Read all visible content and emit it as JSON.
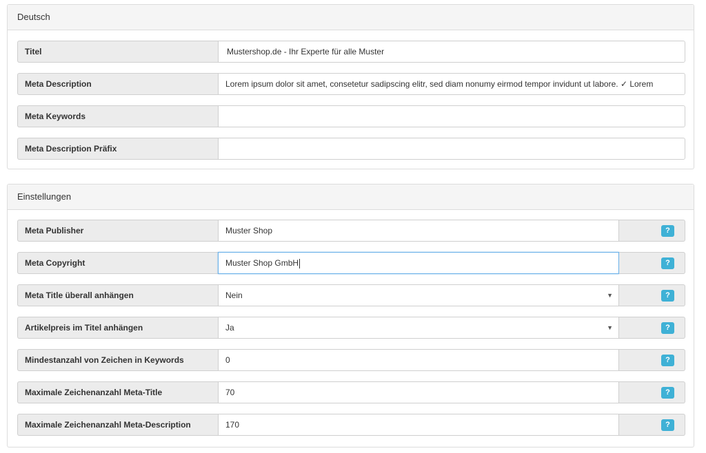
{
  "deutsch": {
    "title": "Deutsch",
    "fields": [
      {
        "label": "Titel",
        "value": "Mustershop.de - Ihr Experte für alle Muster"
      },
      {
        "label": "Meta Description",
        "value": "Lorem ipsum dolor sit amet, consetetur sadipscing elitr, sed diam nonumy eirmod tempor invidunt ut labore. ✓ Lorem"
      },
      {
        "label": "Meta Keywords",
        "value": ""
      },
      {
        "label": "Meta Description Präfix",
        "value": ""
      }
    ]
  },
  "einstellungen": {
    "title": "Einstellungen",
    "fields": [
      {
        "label": "Meta Publisher",
        "value": "Muster Shop"
      },
      {
        "label": "Meta Copyright",
        "value": "Muster Shop GmbH"
      },
      {
        "label": "Meta Title überall anhängen",
        "value": "Nein"
      },
      {
        "label": "Artikelpreis im Titel anhängen",
        "value": "Ja"
      },
      {
        "label": "Mindestanzahl von Zeichen in Keywords",
        "value": "0"
      },
      {
        "label": "Maximale Zeichenanzahl Meta-Title",
        "value": "70"
      },
      {
        "label": "Maximale Zeichenanzahl Meta-Description",
        "value": "170"
      }
    ],
    "help_label": "?",
    "select_arrow": "▼"
  }
}
